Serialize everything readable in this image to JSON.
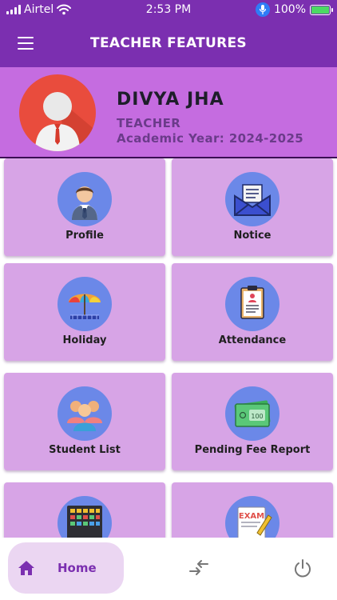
{
  "status_bar": {
    "carrier": "Airtel",
    "time": "2:53 PM",
    "battery": "100%",
    "icons": [
      "signal-icon",
      "wifi-icon",
      "microphone-icon",
      "battery-icon"
    ]
  },
  "app_bar": {
    "title": "TEACHER FEATURES",
    "menu_icon": "hamburger-menu-icon"
  },
  "profile": {
    "name": "DIVYA JHA",
    "role": "TEACHER",
    "academic_year": "Academic Year: 2024-2025",
    "avatar_icon": "teacher-avatar-icon"
  },
  "features": [
    {
      "label": "Profile",
      "icon": "profile-icon"
    },
    {
      "label": "Notice",
      "icon": "notice-envelope-icon"
    },
    {
      "label": "Holiday",
      "icon": "holiday-umbrella-icon"
    },
    {
      "label": "Attendance",
      "icon": "attendance-clipboard-icon"
    },
    {
      "label": "Student List",
      "icon": "student-group-icon"
    },
    {
      "label": "Pending Fee Report",
      "icon": "fee-money-icon"
    },
    {
      "label": "",
      "icon": "calendar-grid-icon"
    },
    {
      "label": "",
      "icon": "exam-icon",
      "icon_text": "EXAM"
    }
  ],
  "bottom_nav": {
    "home_label": "Home",
    "home_icon": "home-icon",
    "switch_icon": "switch-arrows-icon",
    "power_icon": "power-icon"
  },
  "colors": {
    "primary": "#7b2fb0",
    "header_bg": "#c56ce0",
    "card_bg": "#d7a4e6",
    "icon_circle": "#6b88e8",
    "avatar_bg": "#e94c3d",
    "home_pill": "#ebd6f2"
  }
}
